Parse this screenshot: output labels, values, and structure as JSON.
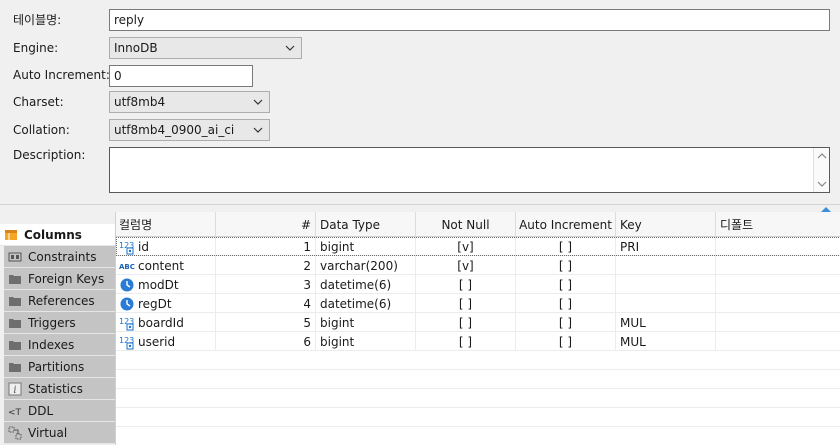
{
  "form": {
    "table_name_label": "테이블명:",
    "table_name_value": "reply",
    "engine_label": "Engine:",
    "engine_value": "InnoDB",
    "auto_increment_label": "Auto Increment:",
    "auto_increment_value": "0",
    "charset_label": "Charset:",
    "charset_value": "utf8mb4",
    "collation_label": "Collation:",
    "collation_value": "utf8mb4_0900_ai_ci",
    "description_label": "Description:",
    "description_value": ""
  },
  "tabs": [
    {
      "label": "Columns",
      "icon": "columns-icon",
      "active": true
    },
    {
      "label": "Constraints",
      "icon": "constraints-icon"
    },
    {
      "label": "Foreign Keys",
      "icon": "folder-icon"
    },
    {
      "label": "References",
      "icon": "folder-icon"
    },
    {
      "label": "Triggers",
      "icon": "folder-icon"
    },
    {
      "label": "Indexes",
      "icon": "folder-icon"
    },
    {
      "label": "Partitions",
      "icon": "folder-icon"
    },
    {
      "label": "Statistics",
      "icon": "info-icon"
    },
    {
      "label": "DDL",
      "icon": "ddl-icon"
    },
    {
      "label": "Virtual",
      "icon": "virtual-icon"
    }
  ],
  "grid": {
    "headers": {
      "name": "컬럼명",
      "num": "#",
      "type": "Data Type",
      "notnull": "Not Null",
      "autoinc": "Auto Increment",
      "key": "Key",
      "default": "디폴트"
    },
    "rows": [
      {
        "icon": "numeric-key-icon",
        "name": "id",
        "num": "1",
        "type": "bigint",
        "notnull": "[v]",
        "autoinc": "[ ]",
        "key": "PRI",
        "default": ""
      },
      {
        "icon": "text-type-icon",
        "name": "content",
        "num": "2",
        "type": "varchar(200)",
        "notnull": "[v]",
        "autoinc": "[ ]",
        "key": "",
        "default": ""
      },
      {
        "icon": "clock-icon",
        "name": "modDt",
        "num": "3",
        "type": "datetime(6)",
        "notnull": "[ ]",
        "autoinc": "[ ]",
        "key": "",
        "default": ""
      },
      {
        "icon": "clock-icon",
        "name": "regDt",
        "num": "4",
        "type": "datetime(6)",
        "notnull": "[ ]",
        "autoinc": "[ ]",
        "key": "",
        "default": ""
      },
      {
        "icon": "numeric-key-icon",
        "name": "boardId",
        "num": "5",
        "type": "bigint",
        "notnull": "[ ]",
        "autoinc": "[ ]",
        "key": "MUL",
        "default": ""
      },
      {
        "icon": "numeric-key-icon",
        "name": "userid",
        "num": "6",
        "type": "bigint",
        "notnull": "[ ]",
        "autoinc": "[ ]",
        "key": "MUL",
        "default": ""
      }
    ]
  },
  "colors": {
    "accent": "#1a73c8",
    "tab_inactive": "#c4c4c4",
    "tab_active": "#ffffff"
  }
}
